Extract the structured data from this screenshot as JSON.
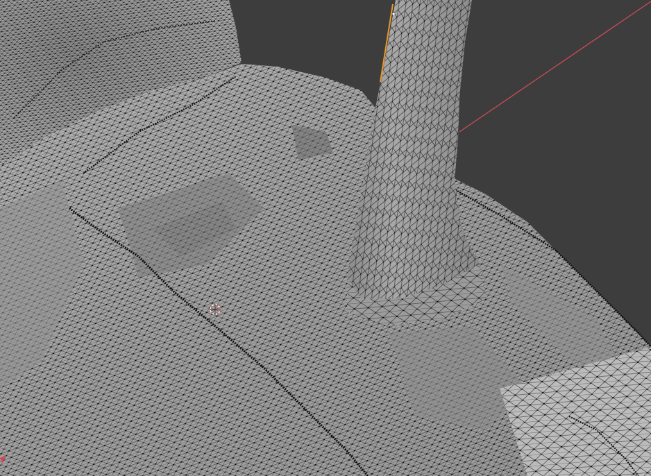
{
  "app": {
    "type": "3d-viewport",
    "mode": "edit-mode-wireframe-overlay"
  },
  "viewport": {
    "background_color": "#3d3d3d",
    "mesh_base_color": "#a6a6a6",
    "mesh_light_color": "#c4c4c4",
    "mesh_shadow_color": "#7e7e7e",
    "wire_color": "#1b1b1b",
    "vertex_color": "#050505",
    "x_axis_color": "#d04a5a",
    "selection_edge_color": "#e89a2a",
    "cursor_colors": [
      "#e05050",
      "#ffffff"
    ]
  }
}
